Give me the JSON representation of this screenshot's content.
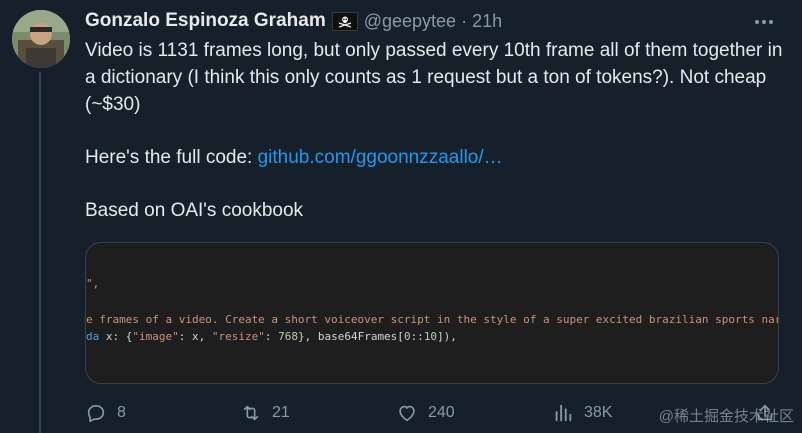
{
  "author": {
    "display_name": "Gonzalo Espinoza Graham",
    "badge_icon": "skull-crossbones-flag-icon",
    "handle": "@geepytee",
    "separator": "·",
    "time": "21h"
  },
  "tweet": {
    "line1": "Video is 1131 frames long, but only passed every 10th frame all of them together in a dictionary (I think this only counts as 1 request but a ton of tokens?). Not cheap (~$30)",
    "line2_prefix": "Here's the full code: ",
    "line2_link": "github.com/ggoonnzzaallo/…",
    "line3": "Based on OAI's cookbook"
  },
  "code_snippet": {
    "line1": "\",",
    "line2": "e frames of a video. Create a short voiceover script in the style of a super excited brazilian sports narra",
    "line3_kw": "da",
    "line3_a": " x: {",
    "line3_s1": "\"image\"",
    "line3_b": ": x, ",
    "line3_s2": "\"resize\"",
    "line3_c": ": ",
    "line3_num": "768",
    "line3_d": "}, base64Frames[",
    "line3_num2": "0",
    "line3_e": "::",
    "line3_num3": "10",
    "line3_f": "]),"
  },
  "actions": {
    "reply_icon": "reply-icon",
    "reply_count": "8",
    "retweet_icon": "retweet-icon",
    "retweet_count": "21",
    "like_icon": "heart-icon",
    "like_count": "240",
    "views_icon": "views-icon",
    "views_count": "38K",
    "share_icon": "share-icon"
  },
  "watermark": "@稀土掘金技术社区",
  "colors": {
    "background": "#15202b",
    "text_primary": "#e7e9ea",
    "text_secondary": "#8b98a5",
    "link": "#1d9bf0"
  }
}
